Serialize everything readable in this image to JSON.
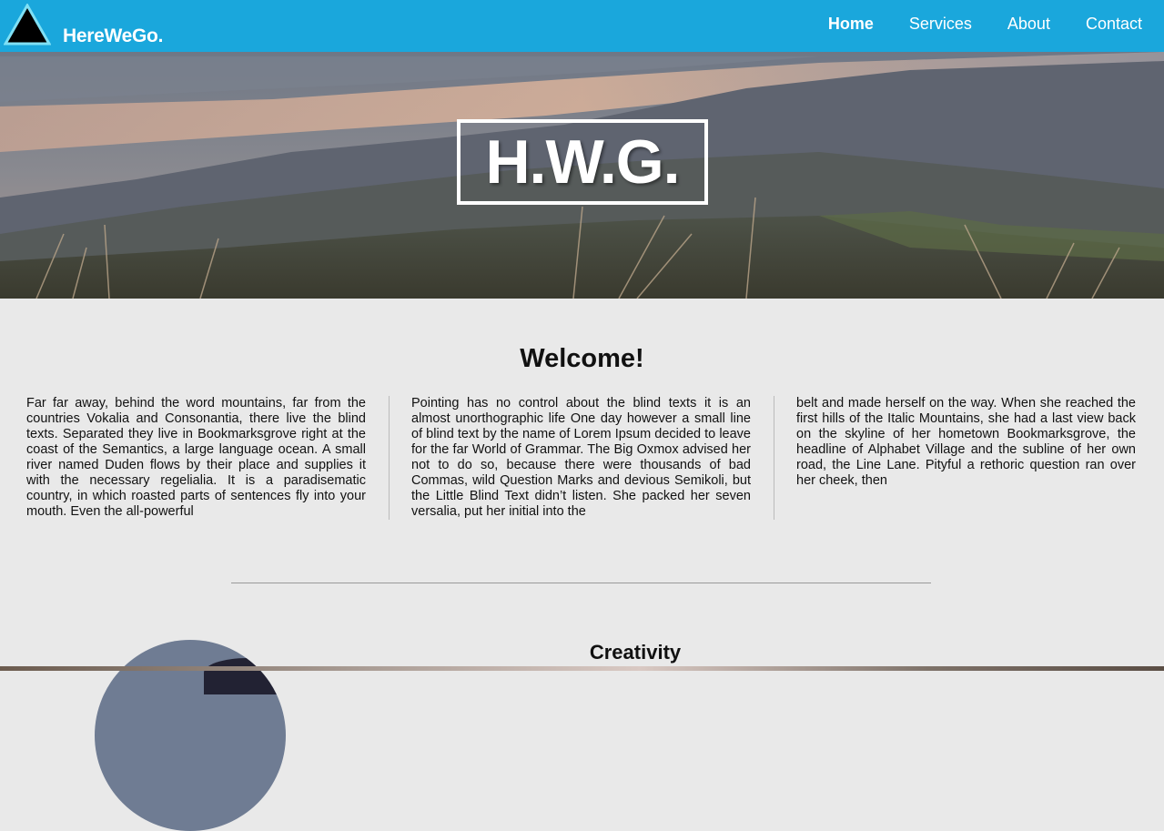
{
  "header": {
    "brand": "HereWeGo.",
    "nav": [
      {
        "label": "Home",
        "active": true
      },
      {
        "label": "Services",
        "active": false
      },
      {
        "label": "About",
        "active": false
      },
      {
        "label": "Contact",
        "active": false
      }
    ]
  },
  "hero": {
    "title": "H.W.G."
  },
  "welcome": {
    "heading": "Welcome!",
    "columns": [
      "Far far away, behind the word mountains, far from the countries Vokalia and Consonantia, there live the blind texts. Separated they live in Bookmarksgrove right at the coast of the Semantics, a large language ocean. A small river named Duden flows by their place and supplies it with the necessary regelialia. It is a paradisematic country, in which roasted parts of sentences fly into your mouth. Even the all-powerful",
      "Pointing has no control about the blind texts it is an almost unorthographic life One day however a small line of blind text by the name of Lorem Ipsum decided to leave for the far World of Grammar. The Big Oxmox advised her not to do so, because there were thousands of bad Commas, wild Question Marks and devious Semikoli, but the Little Blind Text didn’t listen. She packed her seven versalia, put her initial into the",
      "belt and made herself on the way. When she reached the first hills of the Italic Mountains, she had a last view back on the skyline of her hometown Bookmarksgrove, the headline of Alphabet Village and the subline of her own road, the Line Lane. Pityful a rethoric question ran over her cheek, then"
    ]
  },
  "section": {
    "title": "Creativity"
  },
  "colors": {
    "navbar": "#1aa7dc",
    "content_bg": "#e9e9e9",
    "text": "#111111"
  },
  "icons": {
    "logo": "triangle-logo-icon"
  }
}
